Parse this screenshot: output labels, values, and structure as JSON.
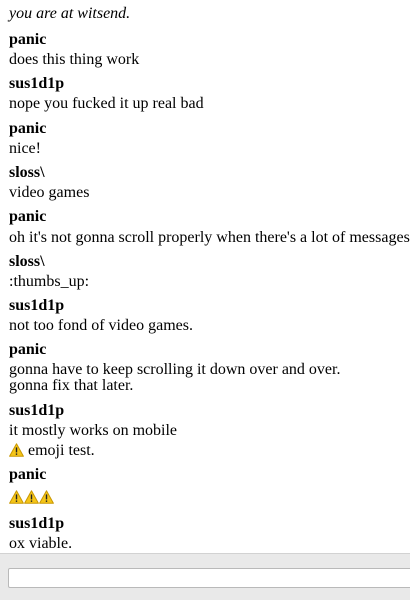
{
  "room": {
    "status": "you are at witsend."
  },
  "messages": [
    {
      "author": "panic",
      "lines": [
        "does this thing work"
      ]
    },
    {
      "author": "sus1d1p",
      "lines": [
        "nope you fucked it up real bad"
      ]
    },
    {
      "author": "panic",
      "lines": [
        "nice!"
      ]
    },
    {
      "author": "sloss\\",
      "lines": [
        "video games"
      ]
    },
    {
      "author": "panic",
      "lines": [
        "oh it's not gonna scroll properly when there's a lot of messages"
      ]
    },
    {
      "author": "sloss\\",
      "lines": [
        ":thumbs_up:"
      ]
    },
    {
      "author": "sus1d1p",
      "lines": [
        "not too fond of video games."
      ]
    },
    {
      "author": "panic",
      "lines": [
        "gonna have to keep scrolling it down over and over.",
        "gonna fix that later."
      ]
    },
    {
      "author": "sus1d1p",
      "lines": [
        "it mostly works on mobile",
        "emoji test."
      ]
    },
    {
      "author": "panic",
      "lines": []
    },
    {
      "author": "sus1d1p",
      "lines": [
        "ox viable."
      ]
    }
  ],
  "icons": {
    "emoji": "warning-sign-icon",
    "emoji_fill": "#f5c518",
    "emoji_stroke": "#c99700"
  },
  "composer": {
    "value": "",
    "placeholder": ""
  }
}
